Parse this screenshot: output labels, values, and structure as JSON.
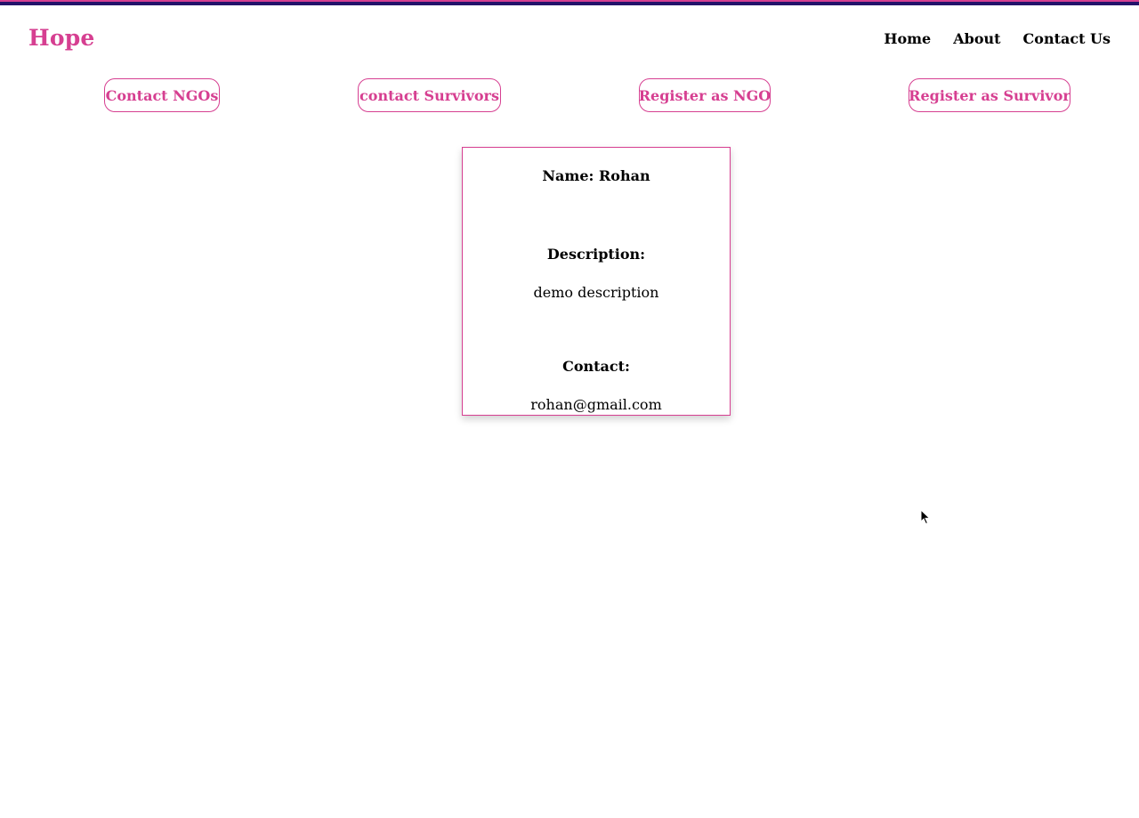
{
  "brand": {
    "name": "Hope",
    "color": "#d63f91"
  },
  "nav": {
    "items": [
      {
        "label": "Home"
      },
      {
        "label": "About"
      },
      {
        "label": "Contact Us"
      }
    ]
  },
  "actions": {
    "items": [
      {
        "label": "Contact NGOs"
      },
      {
        "label": "contact Survivors"
      },
      {
        "label": "Register as NGO"
      },
      {
        "label": "Register as Survivor"
      }
    ]
  },
  "card": {
    "name_line": "Name: Rohan",
    "description_label": "Description:",
    "description_value": "demo description",
    "contact_label": "Contact:",
    "contact_value": "rohan@gmail.com"
  },
  "theme": {
    "accent": "#d63f91",
    "stripe_dark": "#24126a"
  },
  "cursor": {
    "icon": "mouse-pointer-icon"
  }
}
